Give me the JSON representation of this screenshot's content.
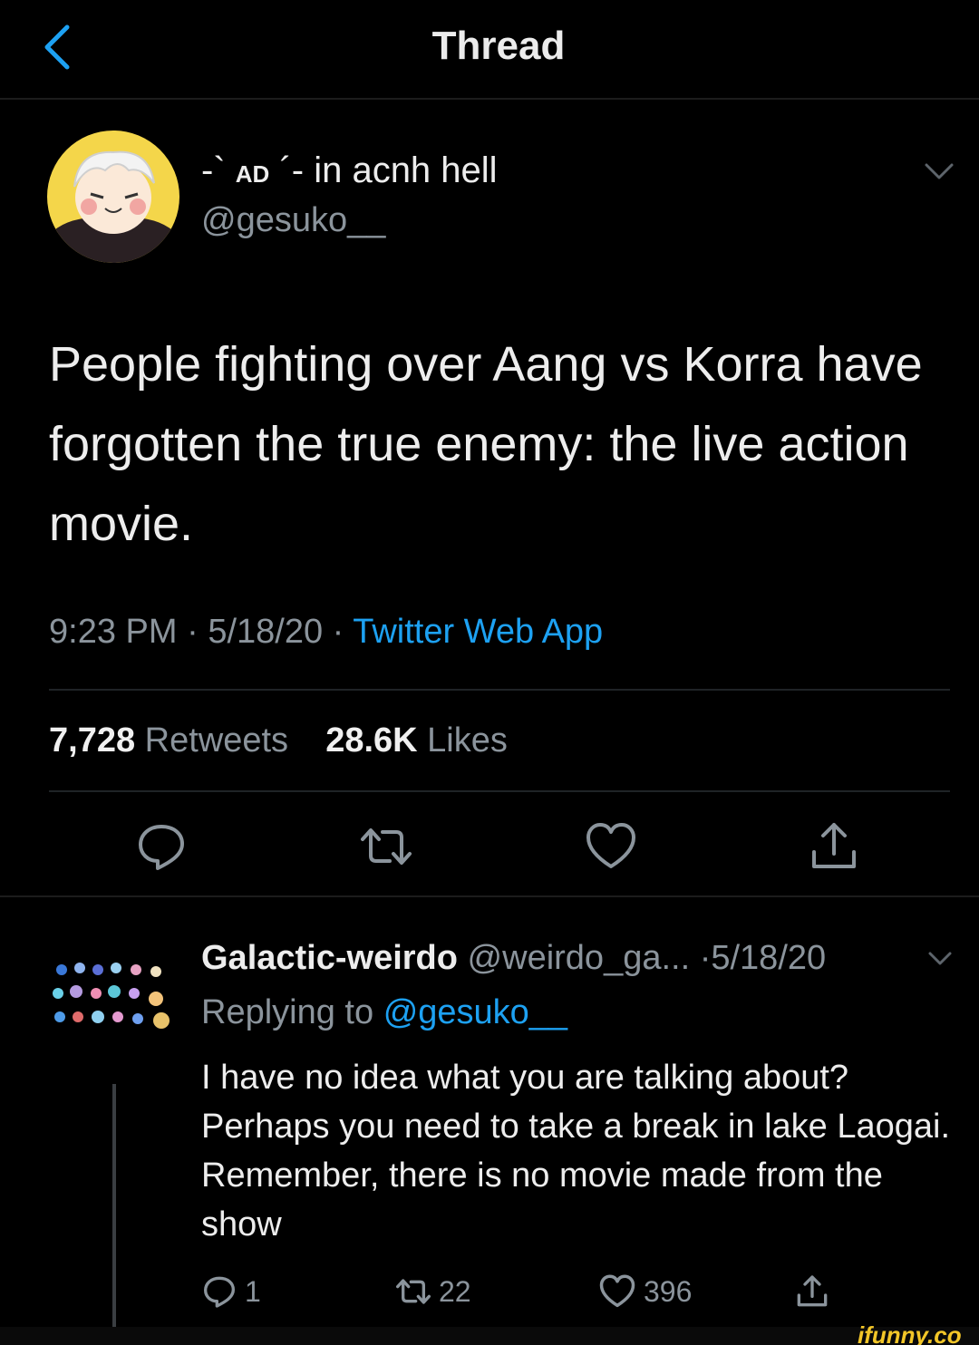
{
  "header": {
    "title": "Thread"
  },
  "tweet": {
    "display_name_prefix": "-` ",
    "display_name_initials": "AD",
    "display_name_suffix": " ´- in acnh hell",
    "handle": "@gesuko__",
    "text": "People fighting over Aang vs Korra have forgotten the true enemy: the live action movie.",
    "time": "9:23 PM",
    "date": "5/18/20",
    "separator": "·",
    "source": "Twitter Web App",
    "retweets_count": "7,728",
    "retweets_label": "Retweets",
    "likes_count": "28.6K",
    "likes_label": "Likes"
  },
  "reply": {
    "name": "Galactic-weirdo",
    "handle": "@weirdo_ga...",
    "separator": "·",
    "date": "5/18/20",
    "replying_to_label": "Replying to",
    "replying_to_handle": "@gesuko__",
    "text": "I have no idea what you are talking about? Perhaps you need to take a break in lake Laogai. Remember, there is no movie made from the show",
    "reply_count": "1",
    "retweet_count": "22",
    "like_count": "396"
  },
  "icons": {
    "back": "chevron-left-icon",
    "caret": "chevron-down-icon",
    "reply": "speech-bubble-icon",
    "retweet": "retweet-arrows-icon",
    "like": "heart-icon",
    "share": "share-upload-icon"
  },
  "colors": {
    "background": "#000000",
    "accent": "#1da1f2",
    "secondary_text": "#8b949c",
    "primary_text": "#ededed",
    "watermark": "#f3c628"
  },
  "watermark": "ifunny.co"
}
